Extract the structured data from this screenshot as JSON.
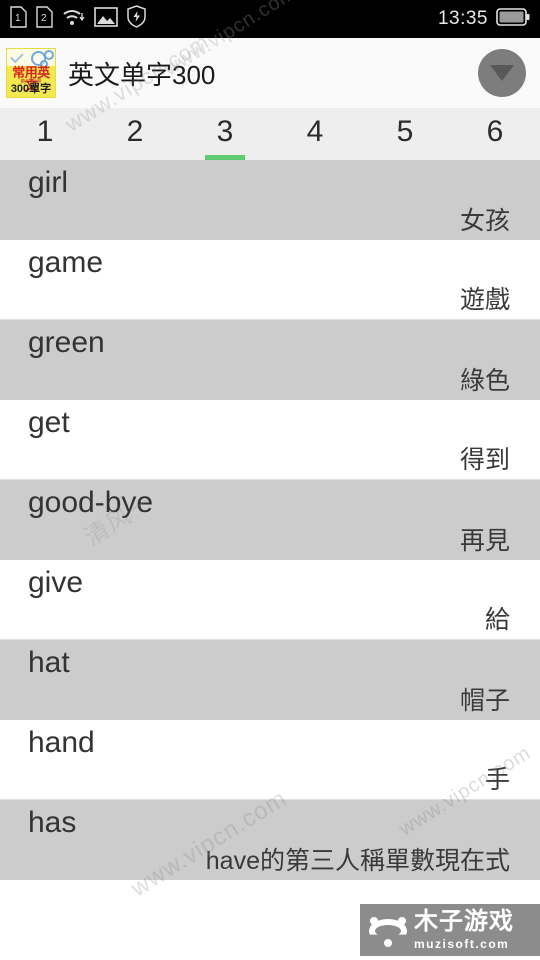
{
  "status_bar": {
    "time": "13:35",
    "icons": [
      {
        "name": "sim1-icon",
        "label": "1"
      },
      {
        "name": "sim2-icon",
        "label": "2"
      },
      {
        "name": "wifi-icon",
        "label": "wifi"
      },
      {
        "name": "screenshot-image-icon",
        "label": "image"
      },
      {
        "name": "shield-bolt-icon",
        "label": "shield"
      }
    ],
    "battery": "battery-icon"
  },
  "header": {
    "app_icon": {
      "name": "app-icon",
      "red_text": "常用英文",
      "sub_text": "英/中對照",
      "bottom_text": "300單字"
    },
    "title": "英文单字300",
    "overflow_button": "dropdown-arrow-button"
  },
  "tabs": {
    "selected_index": 2,
    "items": [
      {
        "label": "1"
      },
      {
        "label": "2"
      },
      {
        "label": "3"
      },
      {
        "label": "4"
      },
      {
        "label": "5"
      },
      {
        "label": "6"
      }
    ],
    "indicator_color": "#5fcc72"
  },
  "word_list": {
    "rows": [
      {
        "en": "girl",
        "zh": "女孩"
      },
      {
        "en": "game",
        "zh": "遊戲"
      },
      {
        "en": "green",
        "zh": "綠色"
      },
      {
        "en": "get",
        "zh": "得到"
      },
      {
        "en": "good-bye",
        "zh": "再見"
      },
      {
        "en": "give",
        "zh": "給"
      },
      {
        "en": "hat",
        "zh": "帽子"
      },
      {
        "en": "hand",
        "zh": "手"
      },
      {
        "en": "has",
        "zh": "have的第三人稱單數現在式"
      }
    ]
  },
  "watermarks": {
    "site_a": "www.vipcn.com",
    "site_b": "清风一",
    "site_c": "www.vipcn.com",
    "site_d": "www.vipcn.com",
    "site_e": "www.vipcn.com",
    "brand_cn": "木子游戏",
    "brand_en": "muzisoft.com"
  },
  "colors": {
    "accent": "#5fcc72",
    "row_alt": "#cccccc",
    "header_bg": "#fafafa",
    "tab_bg": "#eeeeee",
    "status_bg": "#000000"
  }
}
